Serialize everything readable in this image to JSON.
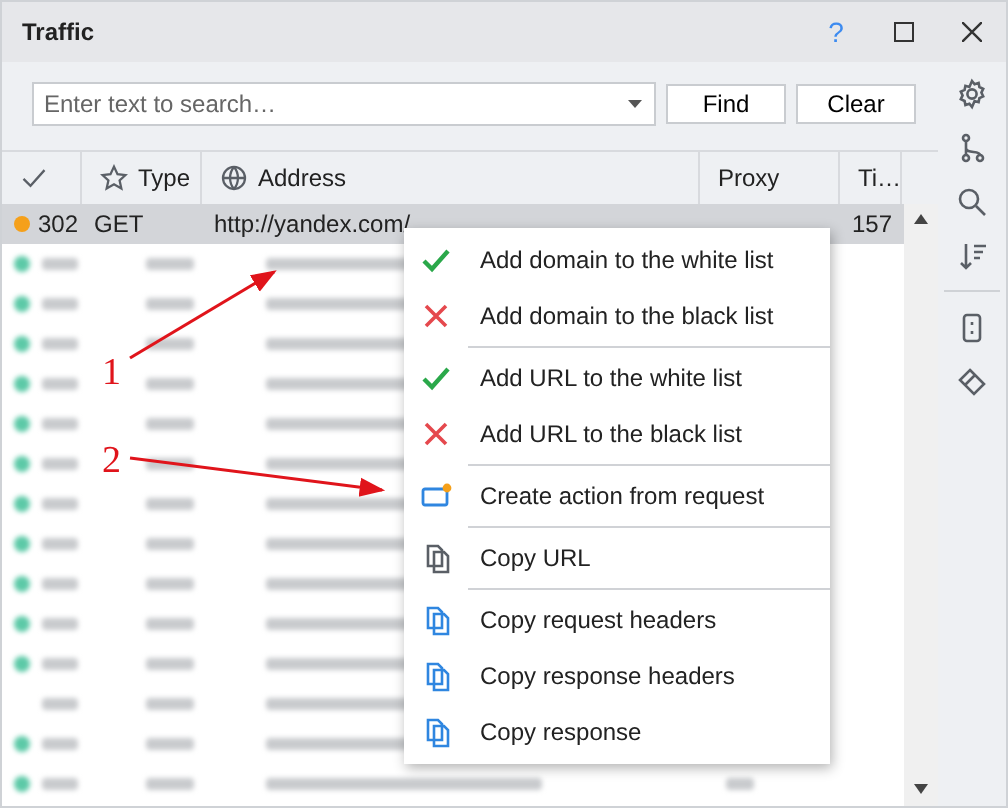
{
  "window": {
    "title": "Traffic",
    "help": "?"
  },
  "search": {
    "placeholder": "Enter text to search…",
    "buttons": [
      "Find",
      "Clear"
    ]
  },
  "table": {
    "columns": [
      {
        "kind": "check"
      },
      {
        "kind": "star",
        "label": "Type"
      },
      {
        "kind": "globe",
        "label": "Address"
      },
      {
        "kind": "plain",
        "label": "Proxy"
      },
      {
        "kind": "plain",
        "label": "Ti…"
      }
    ],
    "rows": [
      {
        "kind": "text",
        "color": "#f5a01a",
        "status": "302",
        "type": "GET",
        "address": "http://yandex.com/",
        "time": "157",
        "selected": true
      },
      {
        "kind": "blurred",
        "color": "#5cc9a7"
      },
      {
        "kind": "blurred",
        "color": "#5cc9a7"
      },
      {
        "kind": "blurred",
        "color": "#5cc9a7"
      },
      {
        "kind": "blurred",
        "color": "#5cc9a7"
      },
      {
        "kind": "blurred",
        "color": "#5cc9a7"
      },
      {
        "kind": "blurred",
        "color": "#5cc9a7"
      },
      {
        "kind": "blurred",
        "color": "#5cc9a7"
      },
      {
        "kind": "blurred",
        "color": "#5cc9a7"
      },
      {
        "kind": "blurred",
        "color": "#5cc9a7"
      },
      {
        "kind": "blurred",
        "color": "#5cc9a7"
      },
      {
        "kind": "blurred",
        "color": "#5cc9a7"
      },
      {
        "kind": "blurred"
      },
      {
        "kind": "blurred",
        "color": "#5cc9a7"
      },
      {
        "kind": "blurred",
        "color": "#5cc9a7"
      }
    ]
  },
  "context_menu": [
    {
      "kind": "allow",
      "label": "Add domain to the white list"
    },
    {
      "kind": "deny",
      "label": "Add domain to the black list"
    },
    {
      "kind": "allow",
      "label": "Add URL to the white list",
      "separator_before": true
    },
    {
      "kind": "deny",
      "label": "Add URL to the black list"
    },
    {
      "kind": "action",
      "label": "Create action from request",
      "separator_before": true
    },
    {
      "kind": "copy",
      "label": "Copy URL",
      "separator_before": true
    },
    {
      "kind": "copy-accent",
      "label": "Copy request headers",
      "separator_before": true
    },
    {
      "kind": "copy-accent",
      "label": "Copy response headers"
    },
    {
      "kind": "copy-accent",
      "label": "Copy response"
    }
  ],
  "annotations": [
    {
      "label": "1"
    },
    {
      "label": "2"
    }
  ]
}
